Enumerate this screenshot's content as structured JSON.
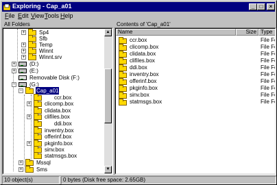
{
  "window": {
    "title": "Exploring - Cap_a01"
  },
  "menu": [
    {
      "label": "File",
      "key": "F",
      "rest": "ile"
    },
    {
      "label": "Edit",
      "key": "E",
      "rest": "dit"
    },
    {
      "label": "View",
      "key": "V",
      "rest": "iew"
    },
    {
      "label": "Tools",
      "key": "T",
      "rest": "ools"
    },
    {
      "label": "Help",
      "key": "H",
      "rest": "elp"
    }
  ],
  "left_pane": {
    "header": "All Folders"
  },
  "right_pane": {
    "header": "Contents of 'Cap_a01'"
  },
  "columns": {
    "name": "Name",
    "size": "Size",
    "type": "Type"
  },
  "tree": {
    "sp4": "Sp4",
    "sfb": "Sfb",
    "temp": "Temp",
    "winnt": "Winnt",
    "winnt_srv": "Winnt.srv",
    "drive_d": "(D:)",
    "drive_e": "(E:)",
    "drive_f": "Removable Disk (F:)",
    "drive_g": "(G:)",
    "cap_a01": "Cap_a01",
    "ccr": "ccr.box",
    "clicomp": "clicomp.box",
    "clidata": "clidata.box",
    "clifiles": "clifiles.box",
    "ddi": "ddi.box",
    "inventry": "inventry.box",
    "offerinf": "offerinf.box",
    "pkginfo": "pkginfo.box",
    "sinv": "sinv.box",
    "statmsgs": "statmsgs.box",
    "mssql": "Mssql",
    "sms": "Sms"
  },
  "files": [
    {
      "name": "ccr.box",
      "type": "File Folder"
    },
    {
      "name": "clicomp.box",
      "type": "File Folder"
    },
    {
      "name": "clidata.box",
      "type": "File Folder"
    },
    {
      "name": "clifiles.box",
      "type": "File Folder"
    },
    {
      "name": "ddi.box",
      "type": "File Folder"
    },
    {
      "name": "inventry.box",
      "type": "File Folder"
    },
    {
      "name": "offerinf.box",
      "type": "File Folder"
    },
    {
      "name": "pkginfo.box",
      "type": "File Folder"
    },
    {
      "name": "sinv.box",
      "type": "File Folder"
    },
    {
      "name": "statmsgs.box",
      "type": "File Folder"
    }
  ],
  "status": {
    "objects": "10 object(s)",
    "space": "0 bytes (Disk free space: 2.65GB)"
  }
}
